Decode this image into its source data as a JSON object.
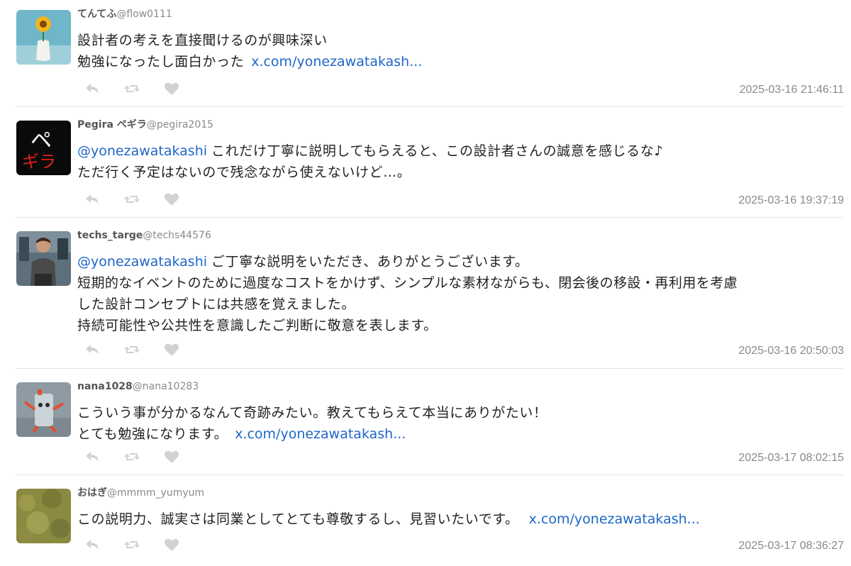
{
  "tweets": [
    {
      "name": "てんてふ",
      "handle": "@flow0111",
      "mention": "",
      "lines": [
        "設計者の考えを直接聞けるのが興味深い",
        "勉強になったし面白かった"
      ],
      "link": "x.com/yonezawatakash...",
      "timestamp": "2025-03-16 21:46:11",
      "avatar_icon": "flower-vase-avatar"
    },
    {
      "name": "Pegira ペギラ",
      "handle": "@pegira2015",
      "mention": "@yonezawatakashi",
      "lines": [
        "これだけ丁寧に説明してもらえると、この設計者さんの誠意を感じるな♪",
        "ただ行く予定はないので残念ながら使えないけど…。"
      ],
      "link": "",
      "timestamp": "2025-03-16 19:37:19",
      "avatar_icon": "pegira-text-avatar",
      "avatar_text_1": "ペ",
      "avatar_text_2": "ギラ"
    },
    {
      "name": "techs_targe",
      "handle": "@techs44576",
      "mention": "@yonezawatakashi",
      "lines": [
        "ご丁寧な説明をいただき、ありがとうございます。",
        "短期的なイベントのために過度なコストをかけず、シンプルな素材ながらも、閉会後の移設・再利用を考慮",
        "した設計コンセプトには共感を覚えました。",
        "持続可能性や公共性を意識したご判断に敬意を表します。"
      ],
      "link": "",
      "timestamp": "2025-03-16 20:50:03",
      "avatar_icon": "person-photo-avatar"
    },
    {
      "name": "nana1028",
      "handle": "@nana10283",
      "mention": "",
      "lines": [
        "こういう事が分かるなんて奇跡みたい。教えてもらえて本当にありがたい！",
        "とても勉強になります。"
      ],
      "link": "x.com/yonezawatakash...",
      "timestamp": "2025-03-17 08:02:15",
      "avatar_icon": "robot-figure-avatar"
    },
    {
      "name": "おはぎ",
      "handle": "@mmmm_yumyum",
      "mention": "",
      "lines": [
        "この説明力、誠実さは同業としてとても尊敬するし、見習いたいです。"
      ],
      "link": "x.com/yonezawatakash...",
      "timestamp": "2025-03-17 08:36:27",
      "avatar_icon": "grass-photo-avatar"
    }
  ],
  "actions": [
    "reply-icon",
    "retweet-icon",
    "like-icon"
  ],
  "colors": {
    "link": "#1e66c8",
    "muted": "#8a8a8a",
    "icon": "#d2d2d2",
    "divider": "#e6e6e6"
  }
}
